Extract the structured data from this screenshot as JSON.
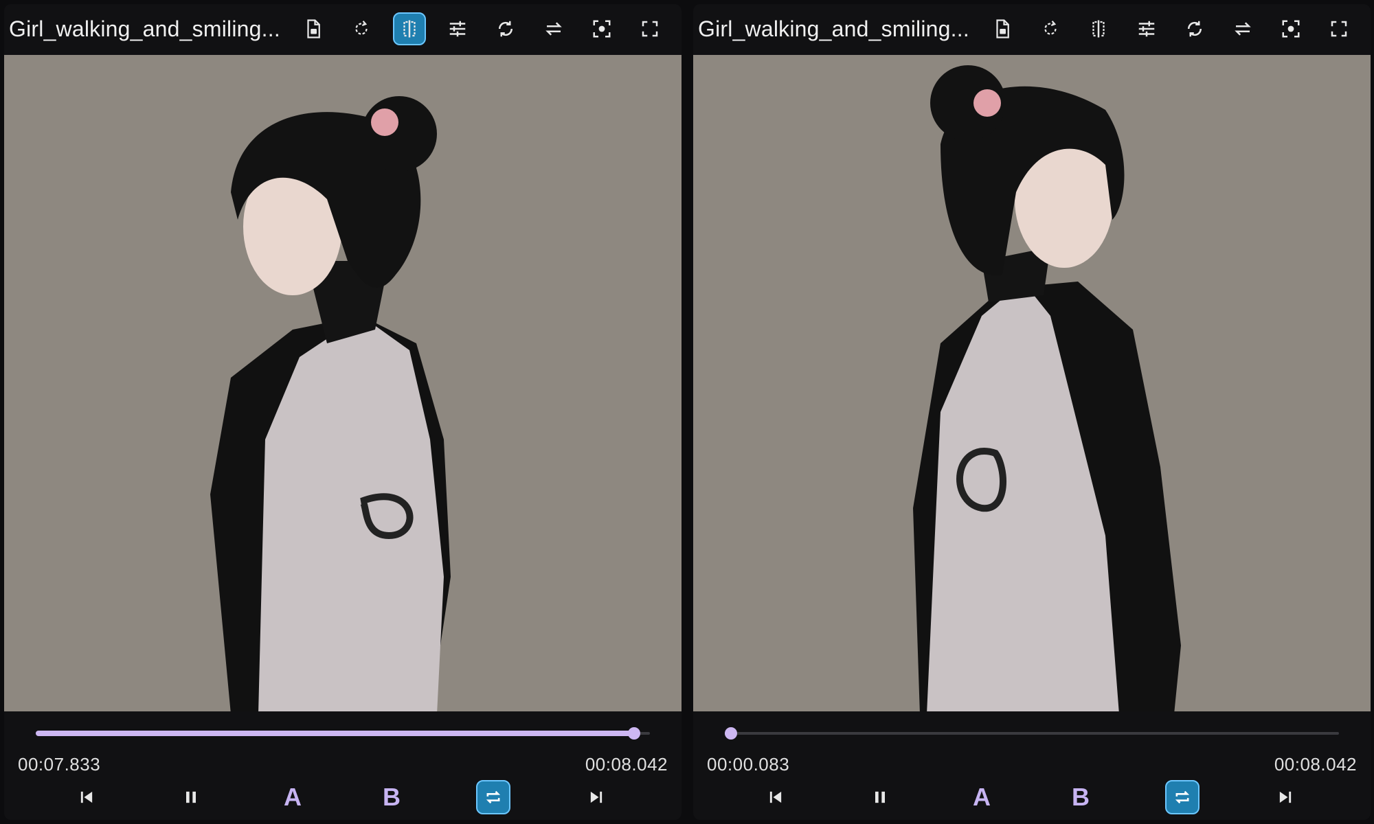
{
  "colors": {
    "accent": "#cdb7f2",
    "active_button": "#1f7fb0",
    "active_border": "#6cc7ff",
    "background": "#0c0c0e",
    "video_backdrop": "#8d877f"
  },
  "panels": [
    {
      "title": "Girl_walking_and_smiling...",
      "toolbar": [
        {
          "icon": "file-info-icon",
          "active": false
        },
        {
          "icon": "rotate-icon",
          "active": false
        },
        {
          "icon": "compare-split-icon",
          "active": true
        },
        {
          "icon": "adjust-sliders-icon",
          "active": false
        },
        {
          "icon": "sync-icon",
          "active": false
        },
        {
          "icon": "swap-icon",
          "active": false
        },
        {
          "icon": "screenshot-icon",
          "active": false
        },
        {
          "icon": "fullscreen-icon",
          "active": false
        }
      ],
      "video": {
        "subject": "woman in profile facing left",
        "facing": "left"
      },
      "playback": {
        "current_time": "00:07.833",
        "duration": "00:08.042",
        "progress": 0.974,
        "buttons": [
          {
            "icon": "skip-previous-icon"
          },
          {
            "icon": "pause-icon"
          },
          {
            "label": "A"
          },
          {
            "label": "B"
          },
          {
            "icon": "loop-icon",
            "active": true
          },
          {
            "icon": "skip-next-icon"
          }
        ]
      }
    },
    {
      "title": "Girl_walking_and_smiling...",
      "toolbar": [
        {
          "icon": "file-info-icon",
          "active": false
        },
        {
          "icon": "rotate-icon",
          "active": false
        },
        {
          "icon": "compare-split-icon",
          "active": false
        },
        {
          "icon": "adjust-sliders-icon",
          "active": false
        },
        {
          "icon": "sync-icon",
          "active": false
        },
        {
          "icon": "swap-icon",
          "active": false
        },
        {
          "icon": "screenshot-icon",
          "active": false
        },
        {
          "icon": "fullscreen-icon",
          "active": false
        }
      ],
      "video": {
        "subject": "woman in profile facing right",
        "facing": "right"
      },
      "playback": {
        "current_time": "00:00.083",
        "duration": "00:08.042",
        "progress": 0.01,
        "buttons": [
          {
            "icon": "skip-previous-icon"
          },
          {
            "icon": "pause-icon"
          },
          {
            "label": "A"
          },
          {
            "label": "B"
          },
          {
            "icon": "loop-icon",
            "active": true
          },
          {
            "icon": "skip-next-icon"
          }
        ]
      }
    }
  ]
}
